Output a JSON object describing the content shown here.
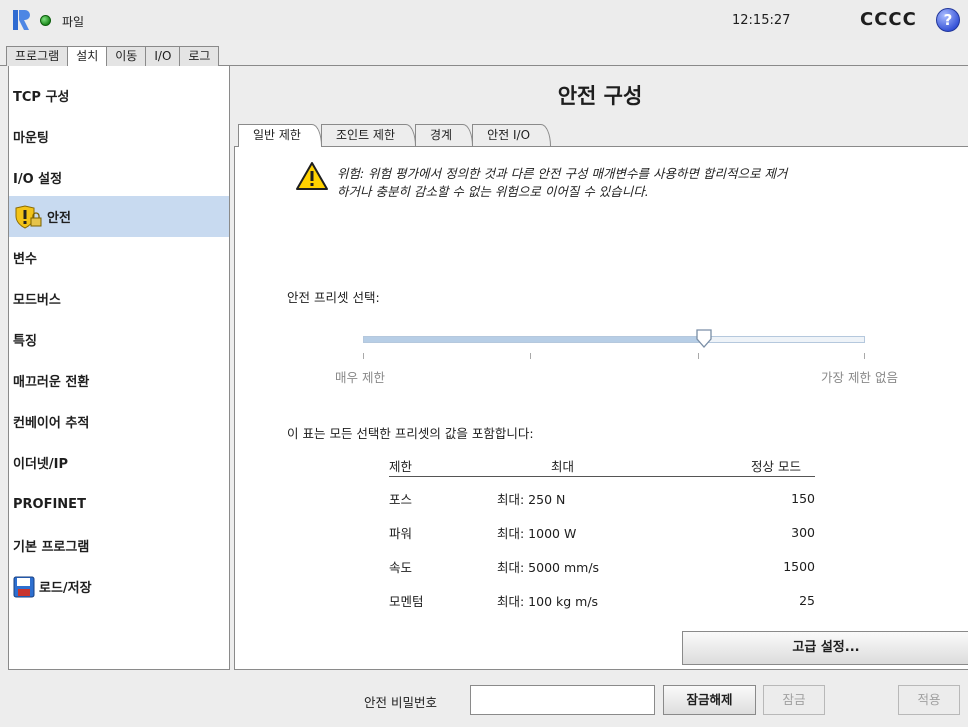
{
  "topbar": {
    "file_menu": "파일",
    "clock": "12:15:27",
    "robot_name": "CCCC",
    "help_glyph": "?",
    "status_color": "#2aa82a"
  },
  "main_tabs": [
    {
      "label": "프로그램",
      "active": false
    },
    {
      "label": "설치",
      "active": true
    },
    {
      "label": "이동",
      "active": false
    },
    {
      "label": "I/O",
      "active": false
    },
    {
      "label": "로그",
      "active": false
    }
  ],
  "sidebar": {
    "items": [
      {
        "label": "TCP 구성",
        "icon": ""
      },
      {
        "label": "마운팅",
        "icon": ""
      },
      {
        "label": "I/O 설정",
        "icon": ""
      },
      {
        "label": "안전",
        "icon": "shield-lock-icon",
        "active": true
      },
      {
        "label": "변수",
        "icon": ""
      },
      {
        "label": "모드버스",
        "icon": ""
      },
      {
        "label": "특징",
        "icon": ""
      },
      {
        "label": "매끄러운 전환",
        "icon": ""
      },
      {
        "label": "컨베이어 추적",
        "icon": ""
      },
      {
        "label": "이더넷/IP",
        "icon": ""
      },
      {
        "label": "PROFINET",
        "icon": ""
      },
      {
        "label": "기본 프로그램",
        "icon": ""
      },
      {
        "label": "로드/저장",
        "icon": "floppy-disk-icon"
      }
    ]
  },
  "content": {
    "title": "안전 구성",
    "sub_tabs": [
      {
        "label": "일반 제한",
        "active": true
      },
      {
        "label": "조인트 제한",
        "active": false
      },
      {
        "label": "경계",
        "active": false
      },
      {
        "label": "안전 I/O",
        "active": false
      }
    ],
    "warning_line1": "위험: 위험 평가에서 정의한 것과 다른 안전 구성 매개변수를 사용하면 합리적으로 제거",
    "warning_line2": "하거나 충분히 감소할 수 없는 위험으로 이어질 수 있습니다.",
    "preset_label": "안전 프리셋 선택:",
    "slider": {
      "value": 0.68,
      "min_label": "매우 제한",
      "max_label": "가장 제한 없음"
    },
    "table_note": "이 표는 모든 선택한 프리셋의 값을 포함합니다:",
    "table": {
      "headers": [
        "제한",
        "최대",
        "정상 모드"
      ],
      "rows": [
        [
          "포스",
          "최대: 250 N",
          "150"
        ],
        [
          "파워",
          "최대: 1000 W",
          "300"
        ],
        [
          "속도",
          "최대: 5000 mm/s",
          "1500"
        ],
        [
          "모멘텀",
          "최대: 100 kg m/s",
          "25"
        ]
      ]
    },
    "advanced_button": "고급 설정..."
  },
  "bottombar": {
    "password_label": "안전 비밀번호",
    "password_value": "",
    "unlock_button": "잠금해제",
    "lock_button": "잠금",
    "apply_button": "적용"
  }
}
